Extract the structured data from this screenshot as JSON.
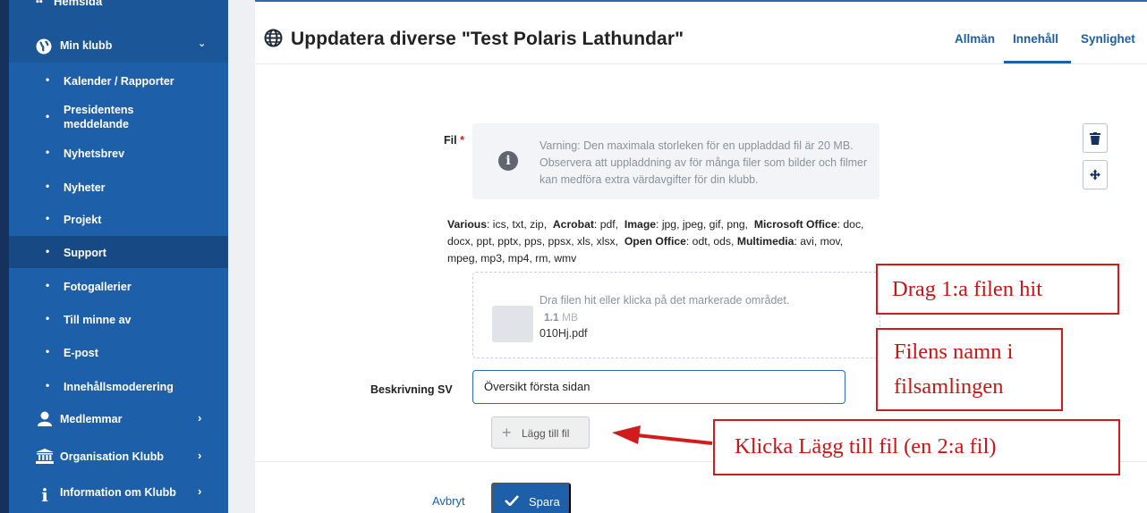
{
  "sidebar": {
    "top_partial": "Hemsida",
    "group": {
      "label": "Min klubb",
      "icon": "globe-icon"
    },
    "items": [
      {
        "label": "Kalender / Rapporter"
      },
      {
        "label": "Presidentens meddelande"
      },
      {
        "label": "Nyhetsbrev"
      },
      {
        "label": "Nyheter"
      },
      {
        "label": "Projekt"
      },
      {
        "label": "Support",
        "active": true
      },
      {
        "label": "Fotogallerier"
      },
      {
        "label": "Till minne av"
      },
      {
        "label": "E-post"
      },
      {
        "label": "Innehållsmoderering"
      }
    ],
    "sections": [
      {
        "label": "Medlemmar",
        "icon": "user-icon"
      },
      {
        "label": "Organisation Klubb",
        "icon": "institution-icon"
      },
      {
        "label": "Information om Klubb",
        "icon": "info-icon"
      }
    ]
  },
  "header": {
    "title": "Uppdatera diverse \"Test Polaris Lathundar\"",
    "tabs": [
      {
        "label": "Allmän"
      },
      {
        "label": "Innehåll",
        "active": true
      },
      {
        "label": "Synlighet"
      }
    ]
  },
  "form": {
    "file_label": "Fil",
    "required_mark": "*",
    "warning": "Varning: Den maximala storleken för en uppladdad fil är 20 MB. Observera att uppladdning av för många filer som bilder och filmer kan medföra extra värdavgifter för din klubb.",
    "types": [
      {
        "name": "Various",
        "ext": ": ics, txt, zip,"
      },
      {
        "name": "Acrobat",
        "ext": ": pdf,"
      },
      {
        "name": "Image",
        "ext": ": jpg, jpeg, gif, png,"
      },
      {
        "name": "Microsoft Office",
        "ext": ": doc, docx, ppt, pptx, pps, ppsx, xls, xlsx,"
      },
      {
        "name": "Open Office",
        "ext": ": odt, ods,"
      },
      {
        "name": "Multimedia",
        "ext": ": avi, mov, mpeg, mp3, mp4, rm, wmv"
      }
    ],
    "drop_hint": "Dra filen hit eller klicka på det markerade området.",
    "file_size_value": "1.1",
    "file_size_unit": "MB",
    "file_name": "010Hj.pdf",
    "description_label": "Beskrivning SV",
    "description_value": "Översikt första sidan",
    "add_file_label": "Lägg till fil",
    "cancel_label": "Avbryt",
    "save_label": "Spara"
  },
  "annotations": {
    "drag_note": "Drag 1:a filen hit",
    "name_note_line1": "Filens namn i",
    "name_note_line2": "filsamlingen",
    "click_note": "Klicka Lägg till fil (en 2:a fil)"
  },
  "colors": {
    "sidebar": "#1d5fa8",
    "accent": "#1d5fa8",
    "annotation": "#d01c1c"
  }
}
